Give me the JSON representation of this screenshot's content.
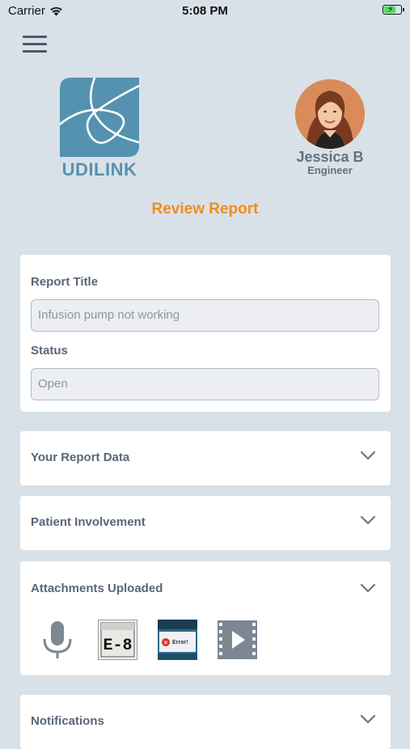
{
  "status_bar": {
    "carrier": "Carrier",
    "time": "5:08 PM"
  },
  "logo": {
    "text": "UDILINK",
    "brand_color": "#5592b0"
  },
  "user": {
    "name": "Jessica B",
    "role": "Engineer"
  },
  "page": {
    "title": "Review Report",
    "accent_color": "#f08c1e"
  },
  "form": {
    "report_title_label": "Report Title",
    "report_title_value": "Infusion pump not working",
    "status_label": "Status",
    "status_value": "Open"
  },
  "sections": [
    {
      "title": "Your Report Data",
      "icon": "chevron-down-icon"
    },
    {
      "title": "Patient Involvement",
      "icon": "chevron-down-icon"
    },
    {
      "title": "Attachments Uploaded",
      "icon": "chevron-down-icon"
    },
    {
      "title": "Notifications",
      "icon": "chevron-down-icon"
    }
  ],
  "attachments": [
    {
      "type": "audio",
      "icon": "microphone-icon"
    },
    {
      "type": "image",
      "icon": "image-thumbnail"
    },
    {
      "type": "image",
      "icon": "image-thumbnail"
    },
    {
      "type": "video",
      "icon": "video-icon"
    }
  ],
  "thumbnail_text": {
    "device_display": "E-8",
    "error_text": "Error!"
  }
}
